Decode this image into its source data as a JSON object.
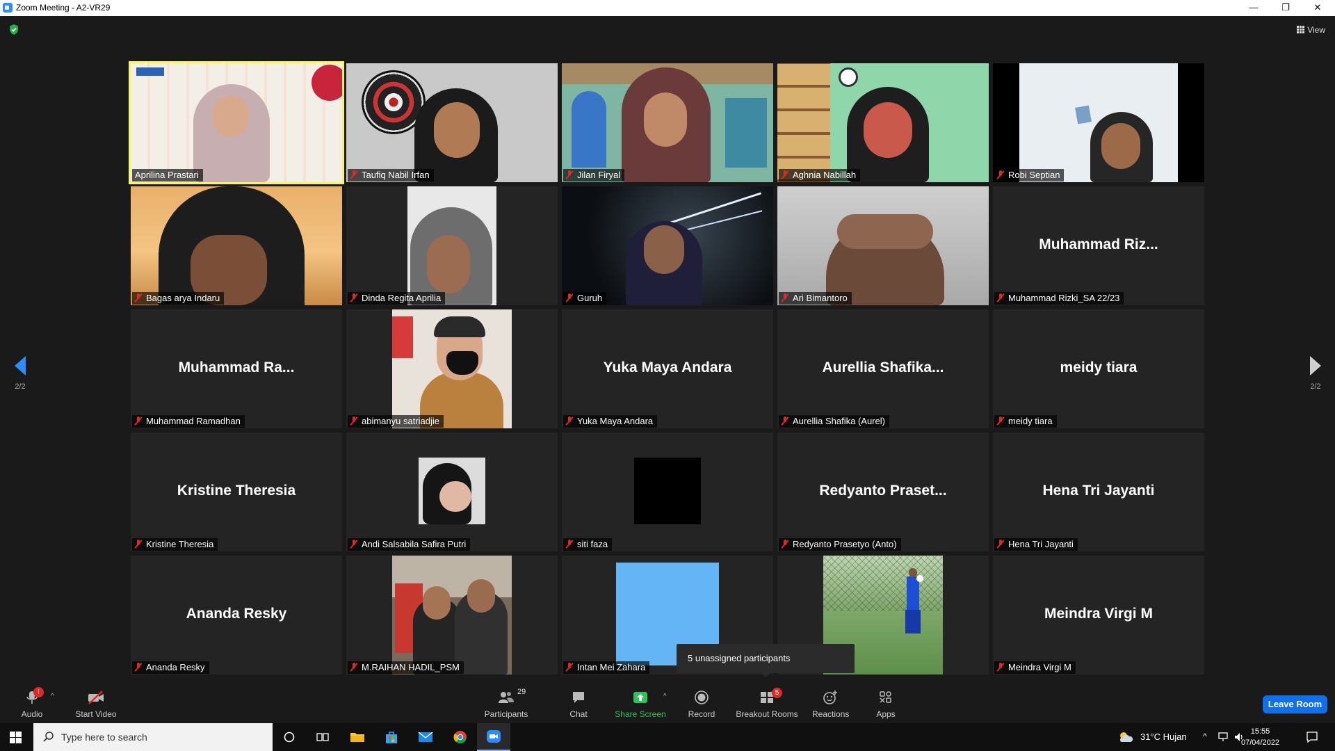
{
  "window": {
    "title": "Zoom Meeting - A2-VR29",
    "minimize": "—",
    "restore": "❐",
    "close": "✕"
  },
  "view_label": "View",
  "page_indicator": {
    "left": "2/2",
    "right": "2/2"
  },
  "participants": [
    {
      "id": "p1",
      "name": "Aprilina Prastari",
      "video": true,
      "muted": false,
      "speaking": true
    },
    {
      "id": "p2",
      "name": "Taufiq Nabil Irfan",
      "video": true,
      "muted": true
    },
    {
      "id": "p3",
      "name": "Jilan Firyal",
      "video": true,
      "muted": true
    },
    {
      "id": "p4",
      "name": "Aghnia Nabillah",
      "video": true,
      "muted": true
    },
    {
      "id": "p5",
      "name": "Robi Septian",
      "video": true,
      "muted": true
    },
    {
      "id": "p6",
      "name": "Bagas arya Indaru",
      "video": true,
      "muted": true
    },
    {
      "id": "p7",
      "name": "Dinda Regita Aprilia",
      "video": true,
      "muted": true
    },
    {
      "id": "p8",
      "name": "Guruh",
      "video": true,
      "muted": true
    },
    {
      "id": "p9",
      "name": "Ari Bimantoro",
      "video": true,
      "muted": true
    },
    {
      "id": "p10",
      "name": "Muhammad Rizki_SA 22/23",
      "display": "Muhammad  Riz...",
      "video": false,
      "muted": true
    },
    {
      "id": "p11",
      "name": "Muhammad Ramadhan",
      "display": "Muhammad  Ra...",
      "video": false,
      "muted": true
    },
    {
      "id": "p12",
      "name": "abimanyu satriadjie",
      "video": true,
      "muted": true
    },
    {
      "id": "p13",
      "name": "Yuka Maya Andara",
      "display": "Yuka Maya Andara",
      "video": false,
      "muted": true
    },
    {
      "id": "p14",
      "name": "Aurellia Shafika (Aurel)",
      "display": "Aurellia  Shafika...",
      "video": false,
      "muted": true
    },
    {
      "id": "p15",
      "name": "meidy tiara",
      "display": "meidy tiara",
      "video": false,
      "muted": true
    },
    {
      "id": "p16",
      "name": "Kristine Theresia",
      "display": "Kristine Theresia",
      "video": false,
      "muted": true
    },
    {
      "id": "p17",
      "name": "Andi Salsabila Safira Putri",
      "video": true,
      "muted": true
    },
    {
      "id": "p18",
      "name": "siti faza",
      "video": true,
      "muted": true
    },
    {
      "id": "p19",
      "name": "Redyanto Prasetyo (Anto)",
      "display": "Redyanto  Praset...",
      "video": false,
      "muted": true
    },
    {
      "id": "p20",
      "name": "Hena Tri Jayanti",
      "display": "Hena Tri Jayanti",
      "video": false,
      "muted": true
    },
    {
      "id": "p21",
      "name": "Ananda Resky",
      "display": "Ananda Resky",
      "video": false,
      "muted": true
    },
    {
      "id": "p22",
      "name": "M.RAIHAN HADIL_PSM",
      "video": true,
      "muted": true
    },
    {
      "id": "p23",
      "name": "Intan Mei Zahara",
      "video": true,
      "muted": true
    },
    {
      "id": "p24",
      "name": "",
      "video": true,
      "muted": false
    },
    {
      "id": "p25",
      "name": "Meindra Virgi M",
      "display": "Meindra Virgi M",
      "video": false,
      "muted": true
    }
  ],
  "tooltip": "5 unassigned participants",
  "toolbar": {
    "audio": "Audio",
    "start_video": "Start Video",
    "participants": "Participants",
    "participant_count": "29",
    "chat": "Chat",
    "share_screen": "Share Screen",
    "record": "Record",
    "breakout_rooms": "Breakout Rooms",
    "breakout_badge": "5",
    "reactions": "Reactions",
    "apps": "Apps",
    "leave": "Leave Room",
    "audio_badge": "!"
  },
  "taskbar": {
    "search_placeholder": "Type here to search",
    "weather": "31°C  Hujan",
    "time": "15:55",
    "date": "07/04/2022"
  },
  "colors": {
    "accent_blue": "#2d8cff",
    "speaking_border": "#f7f75a",
    "share_green": "#2ec25b",
    "muted_red": "#e02828",
    "leave_blue": "#0e71eb"
  }
}
